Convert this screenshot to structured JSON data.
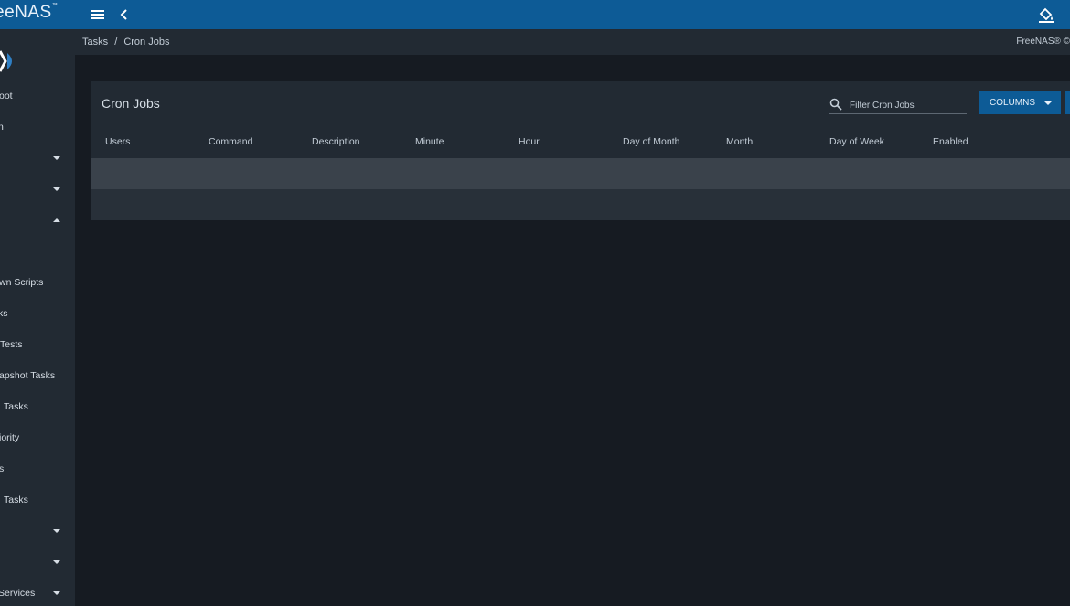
{
  "header": {
    "logo_text": "eeNAS",
    "logo_tm": "™",
    "icons": {
      "menu": "menu-icon",
      "back": "chevron-left-icon",
      "theme": "paint-bucket-icon"
    },
    "accent": "#0d5b96"
  },
  "sidebar": {
    "items": [
      {
        "label": "oot",
        "caret": ""
      },
      {
        "label": "n",
        "caret": ""
      },
      {
        "label": "",
        "caret": "down"
      },
      {
        "label": "",
        "caret": "down"
      },
      {
        "label": "",
        "caret": "up"
      },
      {
        "label": "wn Scripts",
        "caret": ""
      },
      {
        "label": "ks",
        "caret": ""
      },
      {
        "label": "Tests",
        "caret": ""
      },
      {
        "label": "apshot Tasks",
        "caret": ""
      },
      {
        "label": "Tasks",
        "caret": ""
      },
      {
        "label": "iority",
        "caret": ""
      },
      {
        "label": "s",
        "caret": ""
      },
      {
        "label": "Tasks",
        "caret": ""
      },
      {
        "label": "",
        "caret": "down"
      },
      {
        "label": "",
        "caret": "down"
      },
      {
        "label": "Services",
        "caret": "down"
      }
    ]
  },
  "breadcrumb": {
    "parent": "Tasks",
    "separator": "/",
    "current": "Cron Jobs",
    "brand": "FreeNAS® ©"
  },
  "card": {
    "title": "Cron Jobs",
    "search_placeholder": "Filter Cron Jobs",
    "columns_label": "COLUMNS",
    "headers": [
      "Users",
      "Command",
      "Description",
      "Minute",
      "Hour",
      "Day of Month",
      "Month",
      "Day of Week",
      "Enabled"
    ]
  }
}
